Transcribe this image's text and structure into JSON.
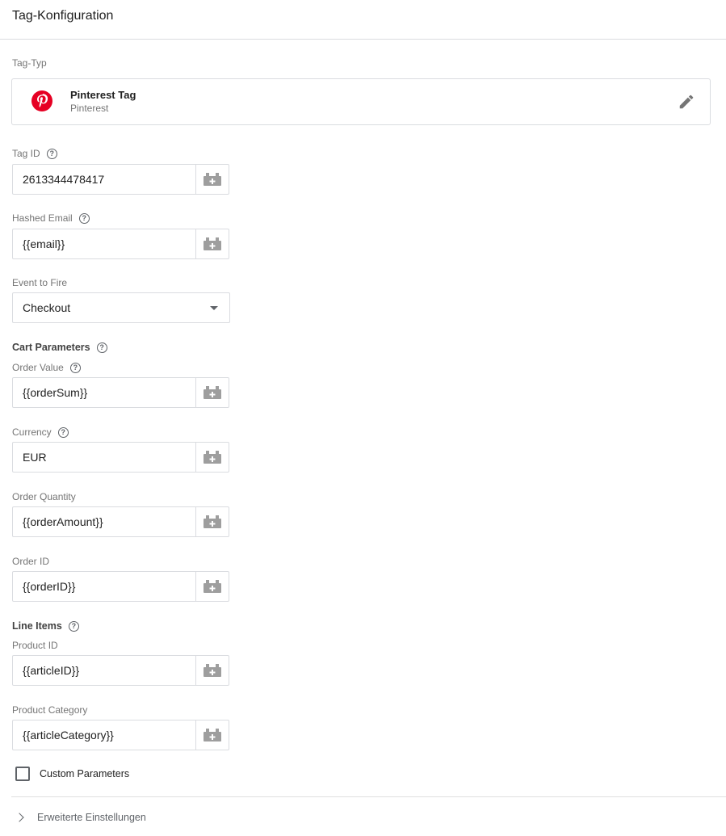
{
  "header": {
    "title": "Tag-Konfiguration"
  },
  "tag_type": {
    "section_label": "Tag-Typ",
    "name": "Pinterest Tag",
    "vendor": "Pinterest",
    "logo_icon": "pinterest-logo",
    "brand_color": "#e60023",
    "edit_icon": "pencil-icon"
  },
  "fields": {
    "tag_id": {
      "label": "Tag ID",
      "value": "2613344478417"
    },
    "hashed_email": {
      "label": "Hashed Email",
      "value": "{{email}}"
    },
    "event_to_fire": {
      "label": "Event to Fire",
      "value": "Checkout"
    },
    "cart_parameters": {
      "heading": "Cart Parameters"
    },
    "order_value": {
      "label": "Order Value",
      "value": "{{orderSum}}"
    },
    "currency": {
      "label": "Currency",
      "value": "EUR"
    },
    "order_quantity": {
      "label": "Order Quantity",
      "value": "{{orderAmount}}"
    },
    "order_id": {
      "label": "Order ID",
      "value": "{{orderID}}"
    },
    "line_items": {
      "heading": "Line Items"
    },
    "product_id": {
      "label": "Product ID",
      "value": "{{articleID}}"
    },
    "product_category": {
      "label": "Product Category",
      "value": "{{articleCategory}}"
    }
  },
  "custom_parameters": {
    "label": "Custom Parameters",
    "checked": false
  },
  "advanced": {
    "label": "Erweiterte Einstellungen"
  },
  "help_glyph": "?",
  "colors": {
    "border": "#dadce0",
    "label": "#757575",
    "icon": "#9e9e9e"
  }
}
